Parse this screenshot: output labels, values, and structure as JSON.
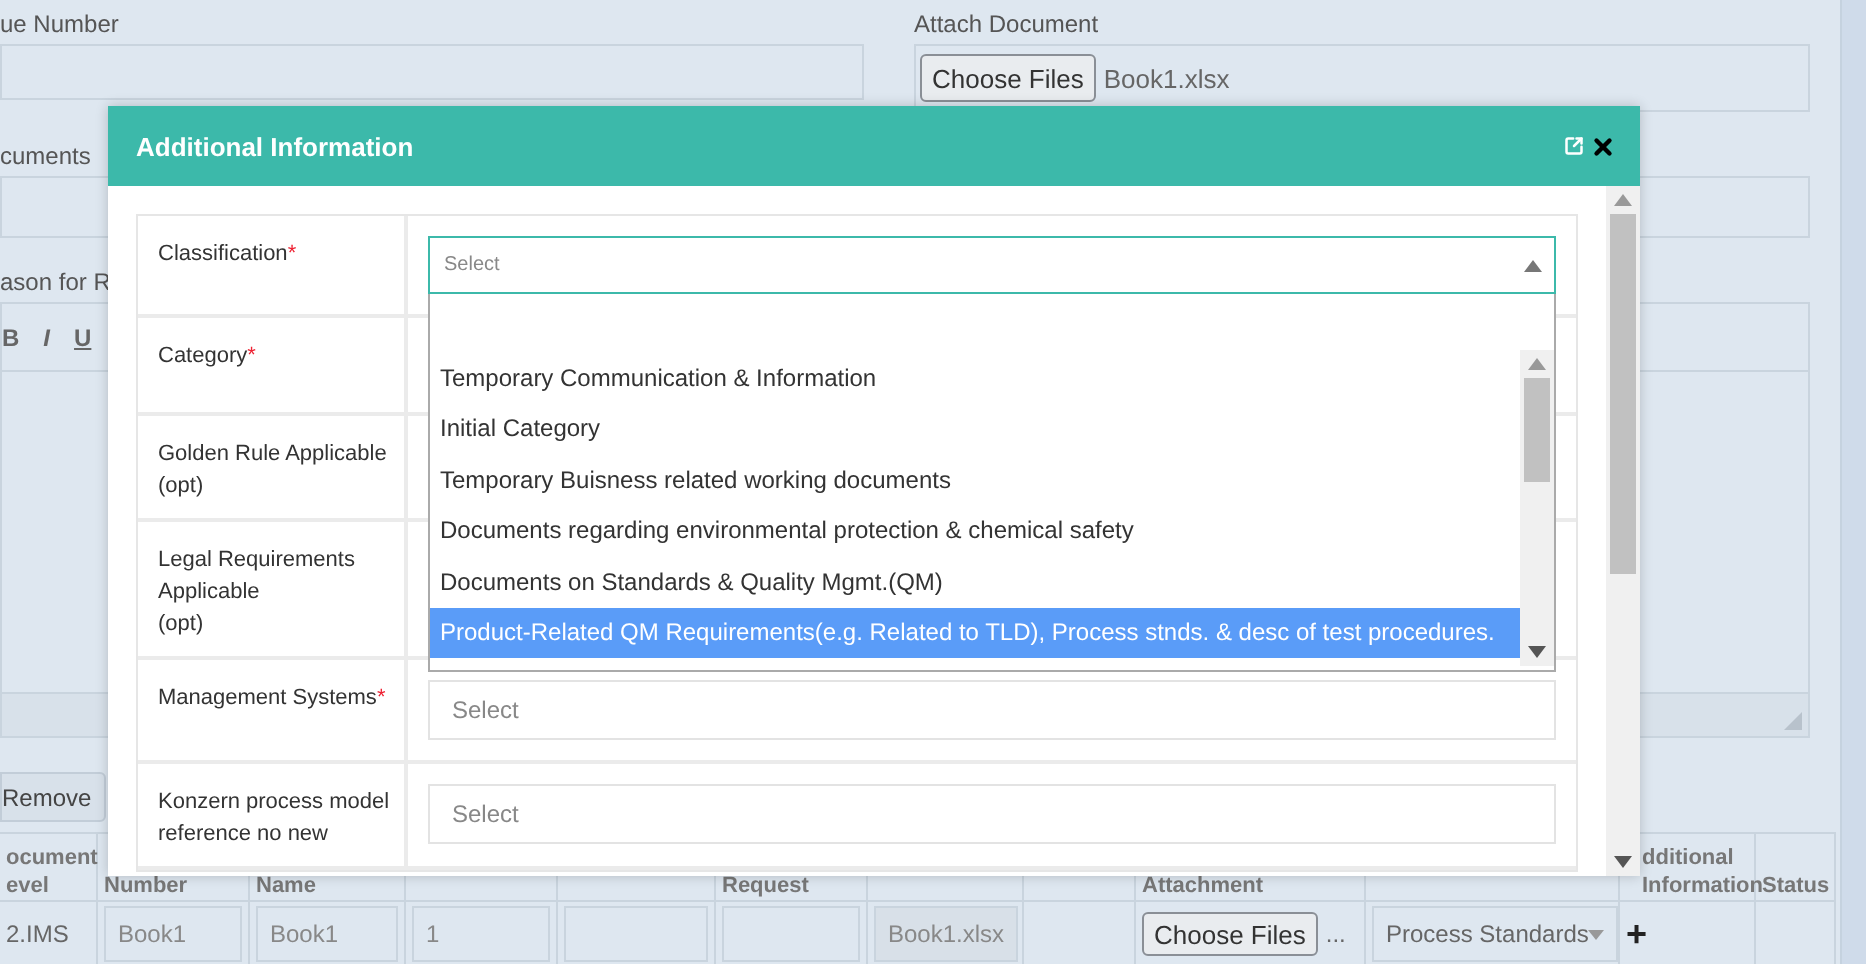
{
  "page": {
    "issue_label": "ue Number",
    "attach": {
      "label": "Attach Document",
      "button": "Choose Files",
      "file": "Book1.xlsx"
    },
    "documents_label": "cuments",
    "reason_label": "ason for R",
    "editor_tools": [
      "B",
      "I",
      "U"
    ],
    "remove_button": "Remove",
    "table": {
      "columns": [
        {
          "lines": [
            "ocument",
            "evel"
          ]
        },
        {
          "lines": [
            "Number"
          ]
        },
        {
          "lines": [
            "Name"
          ]
        },
        {},
        {},
        {
          "lines": [
            "Request"
          ]
        },
        {},
        {},
        {
          "lines": [
            "Attachment"
          ]
        },
        {},
        {
          "lines": [
            "dditional",
            "Information"
          ]
        },
        {
          "lines": [
            "Status"
          ]
        }
      ],
      "row": {
        "level": "2.IMS",
        "number": "Book1",
        "name": "Book1",
        "column_4": "1",
        "file": "Book1.xlsx",
        "attachment_button": "Choose Files",
        "attachment_more": "...",
        "type": "Process Standards",
        "add": "+"
      }
    }
  },
  "dialog": {
    "title": "Additional Information",
    "fields": [
      {
        "label": "Classification",
        "required_mark": "*",
        "kind": "select",
        "placeholder": "Select",
        "open": true,
        "options": [
          {
            "label": "Temporary Communication & Information",
            "selected": false
          },
          {
            "label": "Initial Category",
            "selected": false
          },
          {
            "label": "Temporary Buisness related working documents",
            "selected": false
          },
          {
            "label": "Documents regarding environmental protection & chemical safety",
            "selected": false
          },
          {
            "label": "Documents on Standards & Quality Mgmt.(QM)",
            "selected": false
          },
          {
            "label": "Product-Related QM Requirements(e.g. Related to TLD), Process stnds. & desc of test procedures.",
            "selected": true
          }
        ]
      },
      {
        "label": "Category",
        "required_mark": "*",
        "kind": "none"
      },
      {
        "label": "Golden Rule Applicable",
        "note": "(opt)",
        "kind": "none"
      },
      {
        "label": "Legal Requirements Applicable",
        "note": "(opt)",
        "kind": "none"
      },
      {
        "label": "Management Systems",
        "required_mark": "*",
        "kind": "select",
        "placeholder": "Select",
        "open": false
      },
      {
        "label": "Konzern process model reference no new",
        "kind": "select",
        "placeholder": "Select",
        "open": false
      }
    ]
  }
}
